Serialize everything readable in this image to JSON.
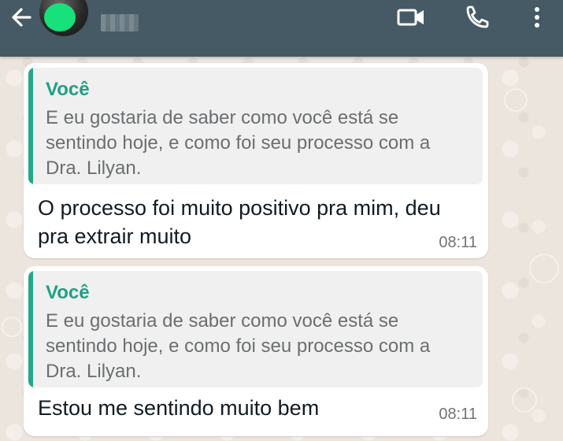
{
  "header": {
    "contact_name": "",
    "icons": {
      "back": "arrow-left-icon",
      "video": "video-call-icon",
      "call": "phone-icon",
      "more": "more-vertical-icon"
    },
    "colors": {
      "bar": "#455a64",
      "avatar_dot": "#18e07a"
    }
  },
  "messages": [
    {
      "quote": {
        "author": "Você",
        "text": "E eu gostaria de saber como você está se sentindo hoje, e como foi seu processo com a Dra. Lilyan."
      },
      "text": "O processo foi muito positivo pra mim, deu pra extrair muito",
      "time": "08:11"
    },
    {
      "quote": {
        "author": "Você",
        "text": "E eu gostaria de saber como você está se sentindo hoje, e como foi seu processo com a Dra. Lilyan."
      },
      "text": "Estou me sentindo muito bem",
      "time": "08:11"
    }
  ],
  "colors": {
    "chat_background": "#ece5dd",
    "bubble": "#ffffff",
    "quote_background": "#f0f0f0",
    "quote_accent": "#25a788",
    "quote_author": "#1fa083"
  }
}
